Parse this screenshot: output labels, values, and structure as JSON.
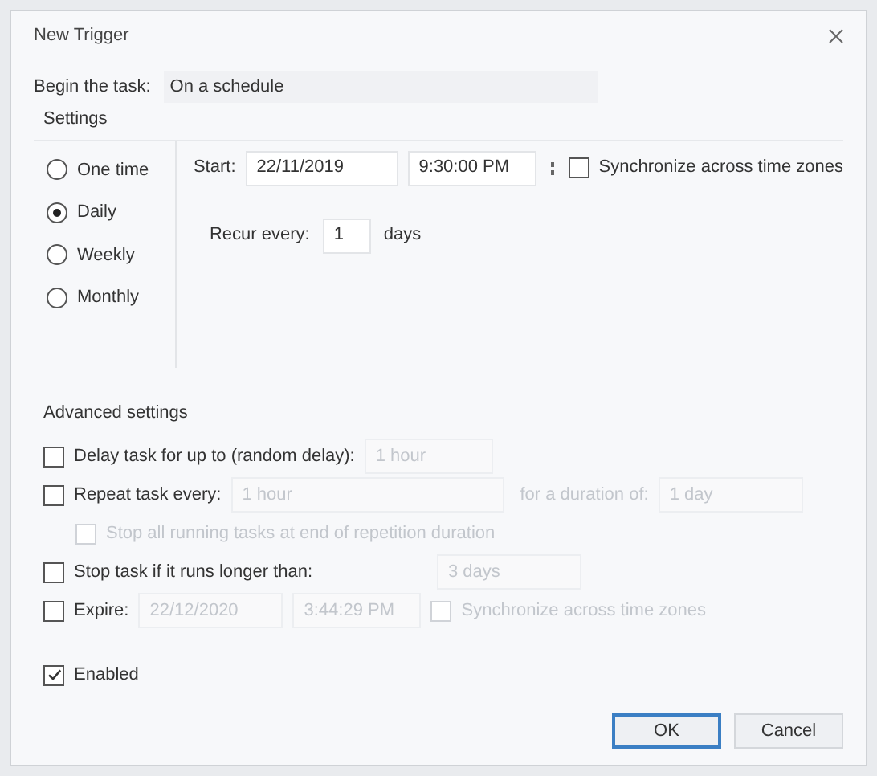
{
  "window": {
    "title": "New Trigger"
  },
  "begin": {
    "label": "Begin the task:",
    "value": "On a schedule"
  },
  "settings": {
    "title": "Settings",
    "schedules": [
      {
        "label": "One time",
        "selected": false
      },
      {
        "label": "Daily",
        "selected": true
      },
      {
        "label": "Weekly",
        "selected": false
      },
      {
        "label": "Monthly",
        "selected": false
      }
    ],
    "start": {
      "label": "Start:",
      "date": "22/11/2019",
      "time": "9:30:00 PM",
      "sync": {
        "label": "Synchronize across time zones",
        "checked": false
      }
    },
    "recur": {
      "label": "Recur every:",
      "value": "1",
      "unit": "days"
    }
  },
  "advanced": {
    "title": "Advanced settings",
    "delay": {
      "label": "Delay task for up to (random delay):",
      "checked": false,
      "value": "1 hour"
    },
    "repeat": {
      "label": "Repeat task every:",
      "checked": false,
      "value": "1 hour",
      "duration_label": "for a duration of:",
      "duration": "1 day",
      "stop_all": {
        "label": "Stop all running tasks at end of repetition duration",
        "checked": false
      }
    },
    "stop": {
      "label": "Stop task if it runs longer than:",
      "checked": false,
      "value": "3 days"
    },
    "expire": {
      "label": "Expire:",
      "checked": false,
      "date": "22/12/2020",
      "time": "3:44:29 PM",
      "sync": {
        "label": "Synchronize across time zones",
        "checked": false
      }
    },
    "enabled": {
      "label": "Enabled",
      "checked": true
    }
  },
  "buttons": [
    {
      "label": "OK",
      "default": true
    },
    {
      "label": "Cancel",
      "default": false
    }
  ]
}
